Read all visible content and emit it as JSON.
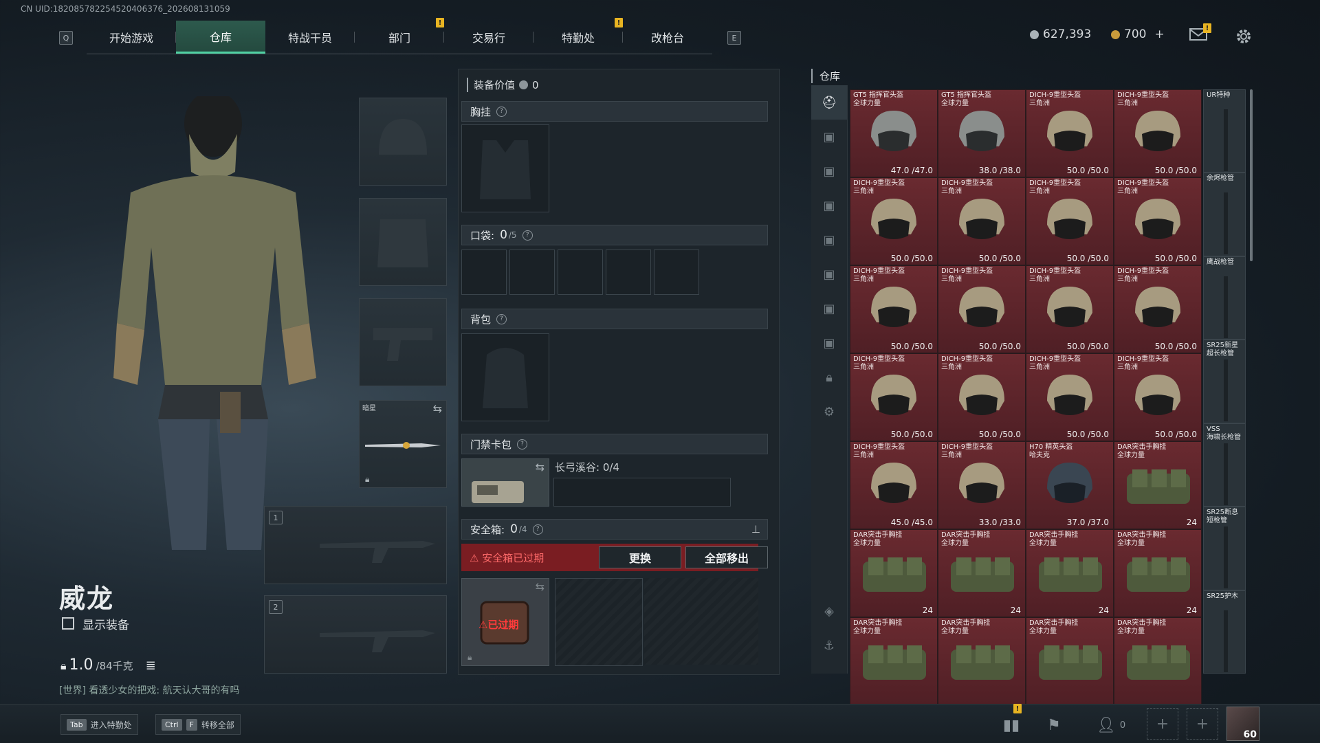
{
  "uid_text": "CN UID:1820857822545204063​76_202608131059",
  "nav": {
    "key_left": "Q",
    "key_right": "E",
    "tabs": [
      {
        "label": "开始游戏"
      },
      {
        "label": "仓库",
        "active": true
      },
      {
        "label": "特战干员"
      },
      {
        "label": "部门"
      },
      {
        "label": "交易行"
      },
      {
        "label": "特勤处"
      },
      {
        "label": "改枪台"
      }
    ]
  },
  "currency": {
    "silver": "627,393",
    "gold": "700",
    "plus": "+"
  },
  "character": {
    "name": "威龙",
    "show_equipment_label": "显示装备",
    "weight_value": "1.0",
    "weight_unit": "/84千克"
  },
  "chat": {
    "channel": "[世界]",
    "message": "看透少女的把戏: 航天认大哥的有吗"
  },
  "equip_slots": {
    "melee_label": "暗星",
    "gun1_num": "1",
    "gun2_num": "2"
  },
  "loadout": {
    "value_label": "装备价值",
    "value": "0",
    "chest_rig": "胸挂",
    "pockets_label": "口袋:",
    "pockets_value": "0",
    "pockets_cap": "/5",
    "backpack": "背包",
    "keycard": "门禁卡包",
    "keycard_map": "长弓溪谷: 0/4",
    "safebox_label": "安全箱:",
    "safebox_value": "0",
    "safebox_cap": "/4",
    "expired_msg": "安全箱已过期",
    "replace_btn": "更换",
    "remove_all_btn": "全部移出",
    "expired_tag": "已过期"
  },
  "warehouse": {
    "title": "仓库",
    "items": [
      {
        "name": "GT5 指挥官头盔",
        "sub": "全球力量",
        "dur": "47.0 /47.0",
        "kind": "helm-g"
      },
      {
        "name": "GT5 指挥官头盔",
        "sub": "全球力量",
        "dur": "38.0 /38.0",
        "kind": "helm-g"
      },
      {
        "name": "DICH-9重型头盔",
        "sub": "三角洲",
        "dur": "50.0 /50.0",
        "kind": "helm"
      },
      {
        "name": "DICH-9重型头盔",
        "sub": "三角洲",
        "dur": "50.0 /50.0",
        "kind": "helm"
      },
      {
        "name": "DICH-9重型头盔",
        "sub": "三角洲",
        "dur": "50.0 /50.0",
        "kind": "helm"
      },
      {
        "name": "DICH-9重型头盔",
        "sub": "三角洲",
        "dur": "50.0 /50.0",
        "kind": "helm"
      },
      {
        "name": "DICH-9重型头盔",
        "sub": "三角洲",
        "dur": "50.0 /50.0",
        "kind": "helm"
      },
      {
        "name": "DICH-9重型头盔",
        "sub": "三角洲",
        "dur": "50.0 /50.0",
        "kind": "helm"
      },
      {
        "name": "DICH-9重型头盔",
        "sub": "三角洲",
        "dur": "50.0 /50.0",
        "kind": "helm"
      },
      {
        "name": "DICH-9重型头盔",
        "sub": "三角洲",
        "dur": "50.0 /50.0",
        "kind": "helm"
      },
      {
        "name": "DICH-9重型头盔",
        "sub": "三角洲",
        "dur": "50.0 /50.0",
        "kind": "helm"
      },
      {
        "name": "DICH-9重型头盔",
        "sub": "三角洲",
        "dur": "50.0 /50.0",
        "kind": "helm"
      },
      {
        "name": "DICH-9重型头盔",
        "sub": "三角洲",
        "dur": "50.0 /50.0",
        "kind": "helm"
      },
      {
        "name": "DICH-9重型头盔",
        "sub": "三角洲",
        "dur": "50.0 /50.0",
        "kind": "helm"
      },
      {
        "name": "DICH-9重型头盔",
        "sub": "三角洲",
        "dur": "50.0 /50.0",
        "kind": "helm"
      },
      {
        "name": "DICH-9重型头盔",
        "sub": "三角洲",
        "dur": "50.0 /50.0",
        "kind": "helm"
      },
      {
        "name": "DICH-9重型头盔",
        "sub": "三角洲",
        "dur": "45.0 /45.0",
        "kind": "helm"
      },
      {
        "name": "DICH-9重型头盔",
        "sub": "三角洲",
        "dur": "33.0 /33.0",
        "kind": "helm"
      },
      {
        "name": "H70 精英头盔",
        "sub": "哈夫克",
        "dur": "37.0 /37.0",
        "kind": "helm-b"
      },
      {
        "name": "DAR突击手胸挂",
        "sub": "全球力量",
        "dur": "24",
        "kind": "vest"
      },
      {
        "name": "DAR突击手胸挂",
        "sub": "全球力量",
        "dur": "24",
        "kind": "vest"
      },
      {
        "name": "DAR突击手胸挂",
        "sub": "全球力量",
        "dur": "24",
        "kind": "vest"
      },
      {
        "name": "DAR突击手胸挂",
        "sub": "全球力量",
        "dur": "24",
        "kind": "vest"
      },
      {
        "name": "DAR突击手胸挂",
        "sub": "全球力量",
        "dur": "24",
        "kind": "vest"
      },
      {
        "name": "DAR突击手胸挂",
        "sub": "全球力量",
        "dur": "",
        "kind": "vest"
      },
      {
        "name": "DAR突击手胸挂",
        "sub": "全球力量",
        "dur": "",
        "kind": "vest"
      },
      {
        "name": "DAR突击手胸挂",
        "sub": "全球力量",
        "dur": "",
        "kind": "vest"
      },
      {
        "name": "DAR突击手胸挂",
        "sub": "全球力量",
        "dur": "",
        "kind": "vest"
      }
    ],
    "side_items": [
      {
        "name": "UR特种"
      },
      {
        "name": "余烬枪管"
      },
      {
        "name": "鹰战枪管"
      },
      {
        "name": "SR25新星\n超长枪管"
      },
      {
        "name": "VSS\n海啸长枪管"
      },
      {
        "name": "SR25断息\n短枪管"
      },
      {
        "name": "SR25护木"
      }
    ]
  },
  "hints": {
    "tab_key": "Tab",
    "tab_text": "进入特勤处",
    "ctrl_key": "Ctrl",
    "f_key": "F",
    "ctrl_text": "转移全部"
  },
  "bottom": {
    "friends": "0",
    "level": "60"
  },
  "icons": [
    "gear-icon",
    "mail-icon",
    "lock-icon",
    "swap-icon",
    "stats-icon",
    "flag-icon",
    "friends-icon",
    "plus-icon",
    "layers-icon",
    "anchor-icon",
    "helmet-icon"
  ]
}
